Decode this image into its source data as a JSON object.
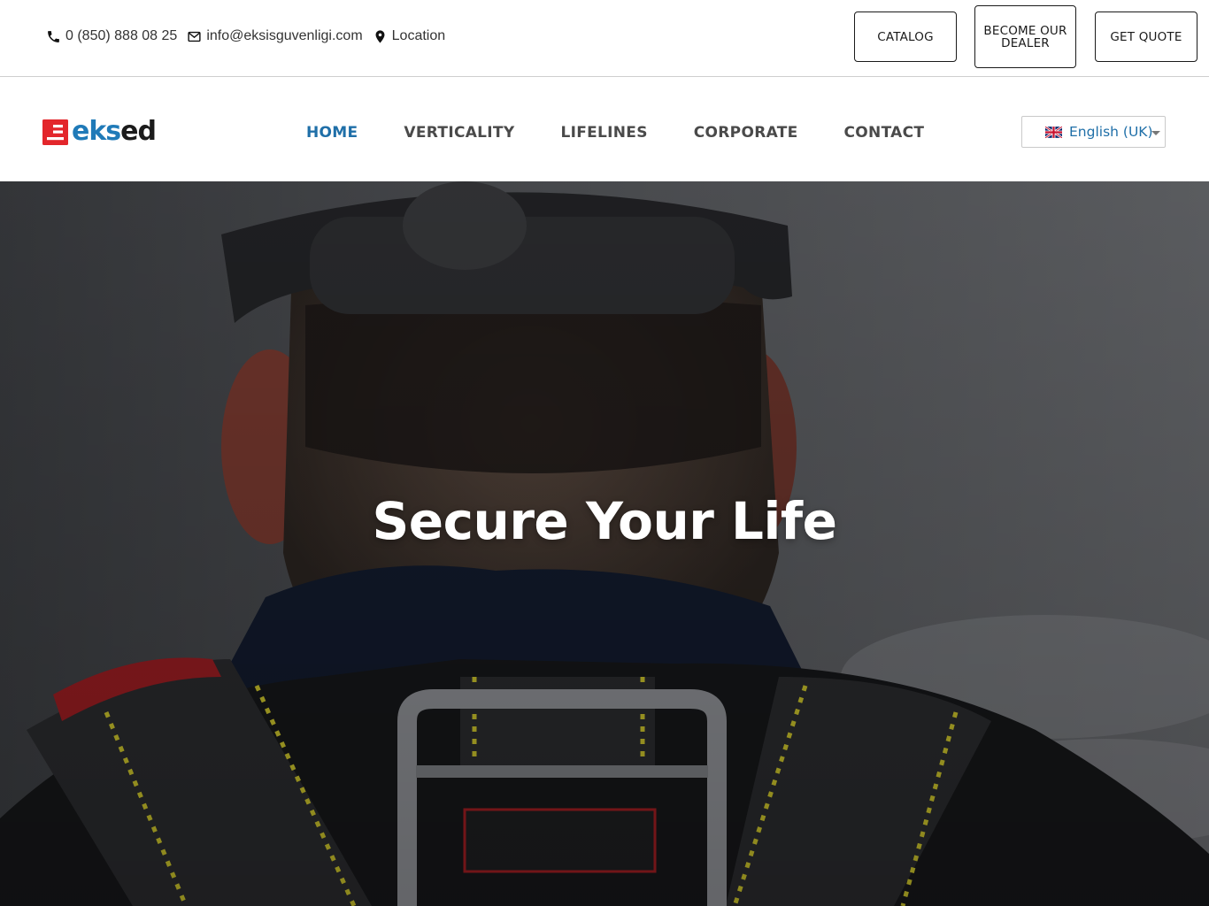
{
  "topbar": {
    "phone": "0 (850) 888 08 25",
    "email": "info@eksisguvenligi.com",
    "location": "Location",
    "buttons": {
      "catalog": "CATALOG",
      "dealer": "BECOME OUR DEALER",
      "quote": "GET QUOTE"
    }
  },
  "brand": {
    "logo_part1": "eks",
    "logo_part2": "ed",
    "logo_color_red": "#e3262b",
    "logo_color_blue": "#1f7ab8"
  },
  "nav": {
    "items": [
      "HOME",
      "VERTICALITY",
      "LIFELINES",
      "CORPORATE",
      "CONTACT"
    ],
    "active_index": 0,
    "active_color": "#1f6fa8"
  },
  "language": {
    "selected": "English (UK)",
    "flag_icon": "uk-flag-icon"
  },
  "hero": {
    "title": "Secure Your Life"
  }
}
